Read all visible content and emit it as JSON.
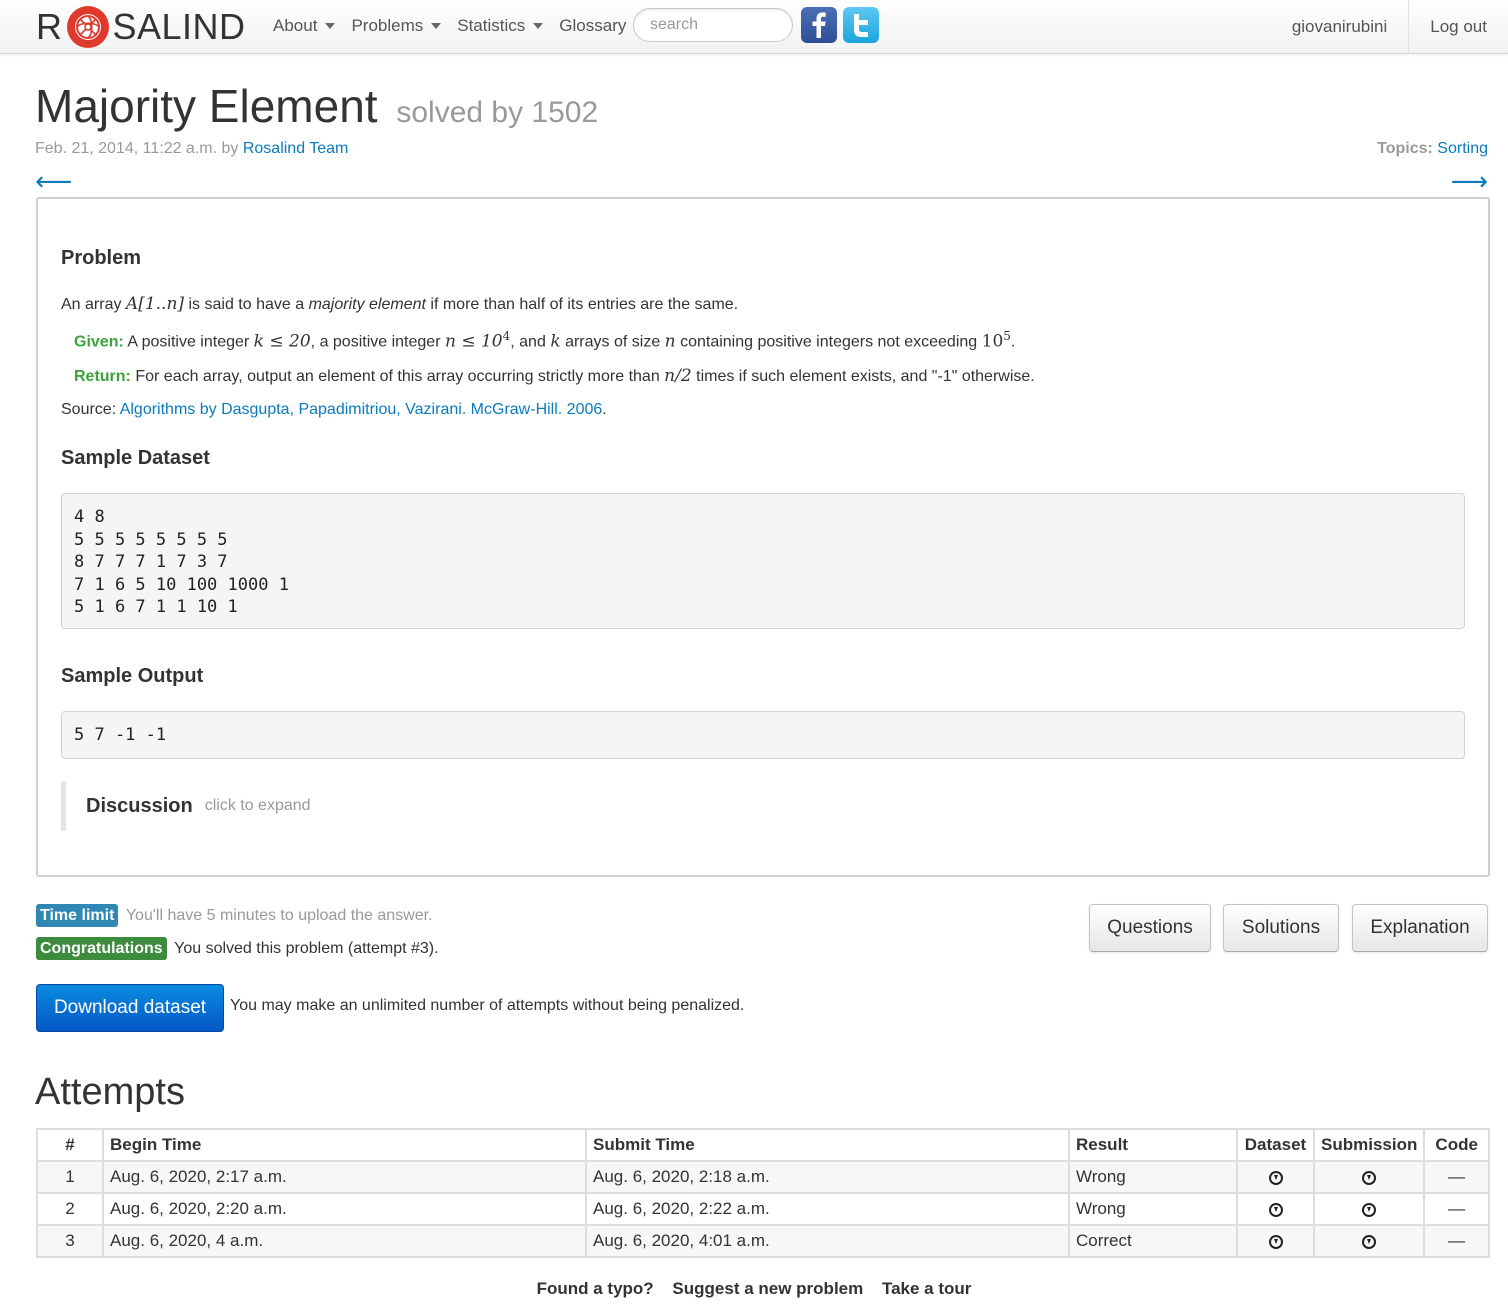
{
  "navbar": {
    "brand_left": "R",
    "brand_right": "SALIND",
    "menu": [
      {
        "label": "About",
        "dropdown": true
      },
      {
        "label": "Problems",
        "dropdown": true
      },
      {
        "label": "Statistics",
        "dropdown": true
      },
      {
        "label": "Glossary",
        "dropdown": false
      }
    ],
    "search_placeholder": "search",
    "user": "giovanirubini",
    "logout": "Log out"
  },
  "header": {
    "title": "Majority Element",
    "solved_by": "solved by 1502",
    "date_prefix": "Feb. 21, 2014, 11:22 a.m. by",
    "author": "Rosalind Team",
    "topics_label": "Topics:",
    "topic": "Sorting",
    "prev_arrow": "⟵",
    "next_arrow": "⟶"
  },
  "problem": {
    "heading": "Problem",
    "intro_1": "An array",
    "intro_math": "A[1..n]",
    "intro_2": "is said to have a",
    "intro_em": "majority element",
    "intro_3": "if more than half of its entries are the same.",
    "given_label": "Given:",
    "given_text_1": "A positive integer",
    "given_math_1": "k ≤ 20",
    "given_text_2": ", a positive integer",
    "given_math_2": "n ≤ 10",
    "given_sup_1": "4",
    "given_text_3": ", and",
    "given_math_3": "k",
    "given_text_4": "arrays of size",
    "given_math_4": "n",
    "given_text_5": "containing positive integers not exceeding",
    "given_num_5": "10",
    "given_sup_2": "5",
    "given_end": ".",
    "return_label": "Return:",
    "return_text_1": "For each array, output an element of this array occurring strictly more than",
    "return_math": "n/2",
    "return_text_2": "times if such element exists, and \"-1\" otherwise.",
    "source_label": "Source:",
    "source_link": "Algorithms by Dasgupta, Papadimitriou, Vazirani. McGraw-Hill. 2006",
    "source_end": "."
  },
  "sample": {
    "dataset_heading": "Sample Dataset",
    "dataset": "4 8\n5 5 5 5 5 5 5 5\n8 7 7 7 1 7 3 7\n7 1 6 5 10 100 1000 1\n5 1 6 7 1 1 10 1",
    "output_heading": "Sample Output",
    "output": "5 7 -1 -1"
  },
  "discussion": {
    "title": "Discussion",
    "hint": "click to expand"
  },
  "status": {
    "time_label": "Time limit",
    "time_text": "You'll have 5 minutes to upload the answer.",
    "congrats_label": "Congratulations",
    "congrats_text": "You solved this problem (attempt #3)."
  },
  "buttons": {
    "questions": "Questions",
    "solutions": "Solutions",
    "explanation": "Explanation",
    "download": "Download dataset",
    "download_note": "You may make an unlimited number of attempts without being penalized."
  },
  "attempts": {
    "heading": "Attempts",
    "columns": [
      "#",
      "Begin Time",
      "Submit Time",
      "Result",
      "Dataset",
      "Submission",
      "Code"
    ],
    "rows": [
      {
        "num": "1",
        "begin": "Aug. 6, 2020, 2:17 a.m.",
        "submit": "Aug. 6, 2020, 2:18 a.m.",
        "result": "Wrong",
        "code": "—"
      },
      {
        "num": "2",
        "begin": "Aug. 6, 2020, 2:20 a.m.",
        "submit": "Aug. 6, 2020, 2:22 a.m.",
        "result": "Wrong",
        "code": "—"
      },
      {
        "num": "3",
        "begin": "Aug. 6, 2020, 4 a.m.",
        "submit": "Aug. 6, 2020, 4:01 a.m.",
        "result": "Correct",
        "code": "—"
      }
    ]
  },
  "footer": {
    "typo": "Found a typo?",
    "suggest": "Suggest a new problem",
    "tour": "Take a tour"
  },
  "colors": {
    "link": "#0a7bbd",
    "given_return": "#3aa43a",
    "label_info": "#2f87b3",
    "label_success": "#3d8b3d",
    "primary_button": "#0458c7"
  },
  "icons": {
    "facebook": "facebook-icon",
    "twitter": "twitter-icon",
    "download": "download-circle-icon"
  }
}
